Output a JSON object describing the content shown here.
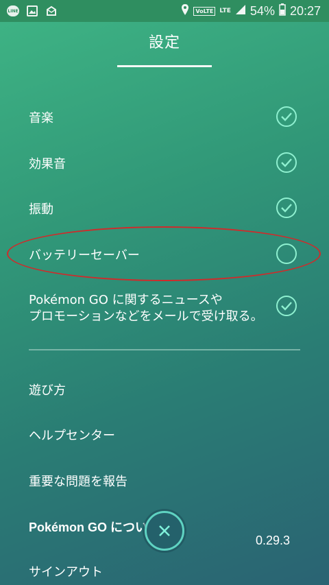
{
  "status_bar": {
    "left_icons": [
      "line-icon",
      "image-icon",
      "mail-notify-icon"
    ],
    "volte": "VoLTE",
    "lte": "LTE",
    "battery": "54%",
    "time": "20:27"
  },
  "header": {
    "title": "設定"
  },
  "settings": [
    {
      "label": "音楽",
      "checked": true
    },
    {
      "label": "効果音",
      "checked": true
    },
    {
      "label": "振動",
      "checked": true
    },
    {
      "label": "バッテリーセーバー",
      "checked": false
    },
    {
      "label_line1": "Pokémon GO に関するニュースや",
      "label_line2": "プロモーションなどをメールで受け取る。",
      "checked": true
    }
  ],
  "menu": {
    "how_to_play": "遊び方",
    "help_center": "ヘルプセンター",
    "report_issue": "重要な問題を報告",
    "about": "Pokémon GO につい",
    "version": "0.29.3",
    "sign_out": "サインアウト"
  },
  "colors": {
    "accent": "#8ff0d0",
    "highlight": "#d12a2a"
  }
}
